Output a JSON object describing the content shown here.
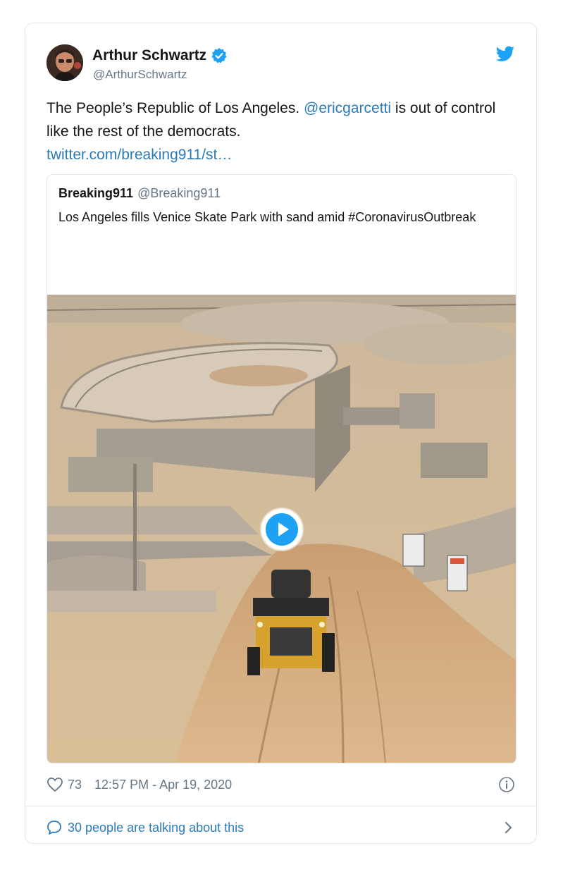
{
  "tweet": {
    "author_name": "Arthur Schwartz",
    "author_handle": "@ArthurSchwartz",
    "text_part1": "The People’s Republic of Los Angeles. ",
    "mention": "@ericgarcetti",
    "text_part2": " is out of control like the rest of the democrats.",
    "link": "twitter.com/breaking911/st…",
    "likes": "73",
    "timestamp": "12:57 PM - Apr 19, 2020",
    "talking": "30 people are talking about this"
  },
  "quote": {
    "name": "Breaking911",
    "handle": "@Breaking911",
    "text": "Los Angeles fills Venice Skate Park with sand amid #CoronavirusOutbreak"
  },
  "icons": {
    "verified": "verified-badge-icon",
    "brand": "twitter-bird-icon",
    "like": "heart-icon",
    "info": "info-icon",
    "talk": "speech-bubble-icon",
    "play": "play-icon",
    "chevron": "chevron-right-icon"
  },
  "colors": {
    "twitter_blue": "#1da1f2",
    "link_blue": "#2b7bb9",
    "muted_gray": "#657786",
    "border": "#e1e8ed"
  }
}
